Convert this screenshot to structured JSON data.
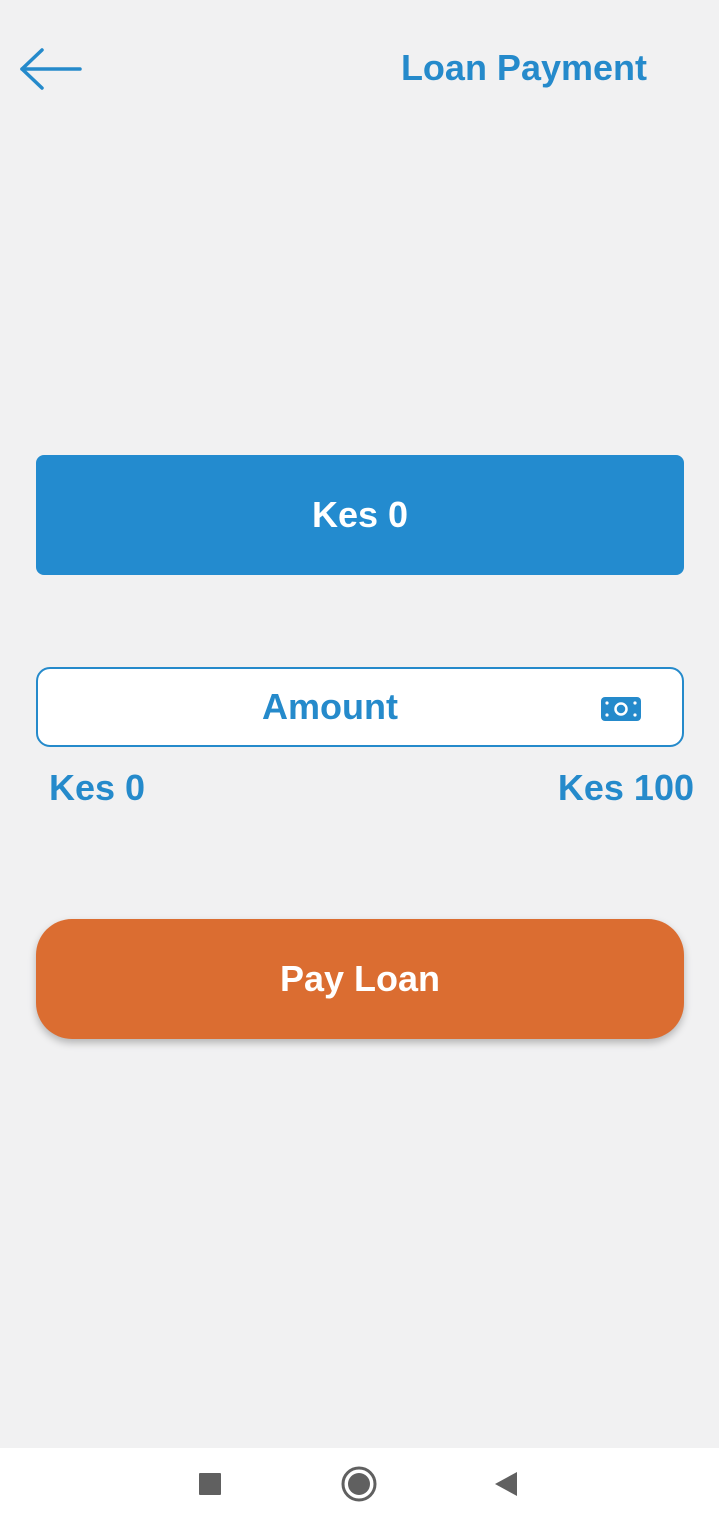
{
  "header": {
    "title": "Loan Payment",
    "back_icon": "arrow-left-icon"
  },
  "balance": {
    "text": "Kes 0"
  },
  "amount_field": {
    "placeholder": "Amount",
    "value": "",
    "icon": "money-icon"
  },
  "range": {
    "min_label": "Kes 0",
    "max_label": "Kes 100"
  },
  "pay_button": {
    "label": "Pay Loan"
  },
  "nav": {
    "recents_icon": "square-icon",
    "home_icon": "circle-icon",
    "back_icon": "triangle-back-icon"
  },
  "colors": {
    "primary": "#258acb",
    "card_blue": "#238bcf",
    "accent_orange": "#db6d31",
    "background": "#f1f1f2"
  }
}
